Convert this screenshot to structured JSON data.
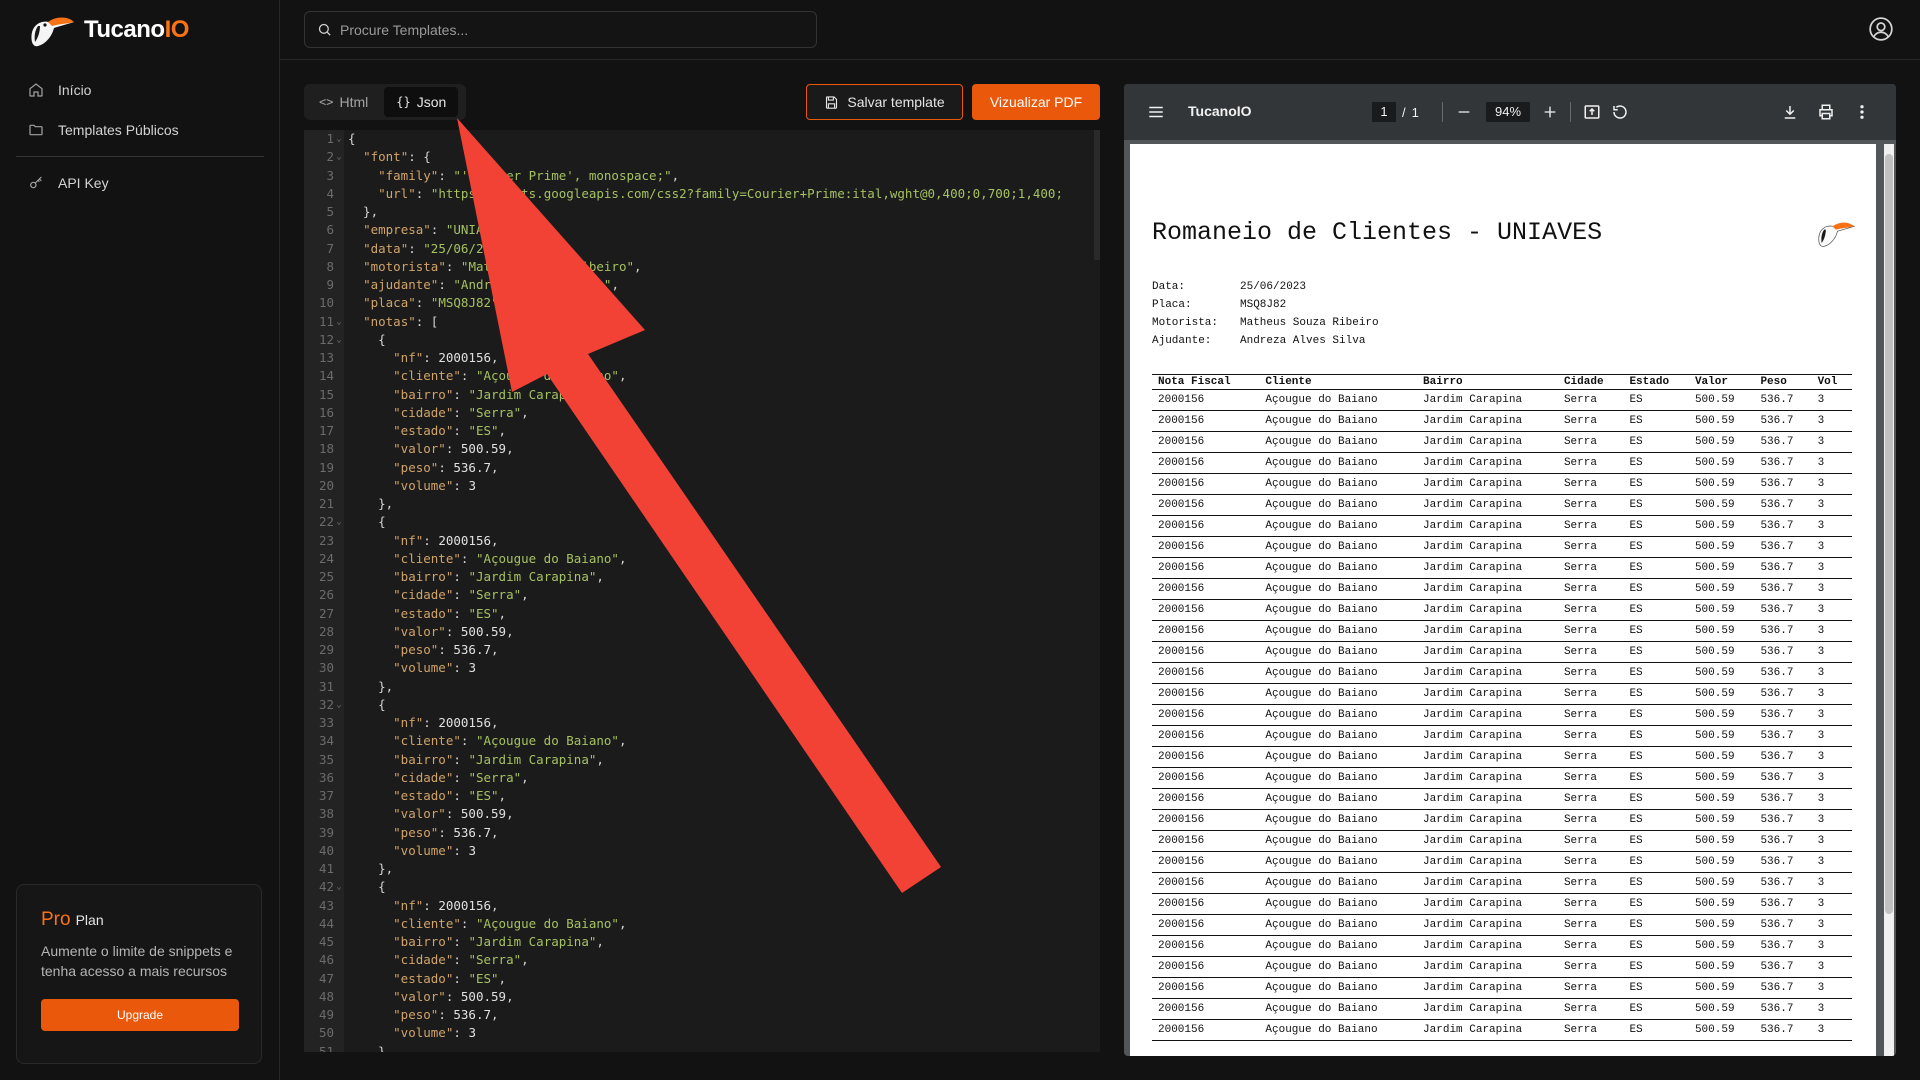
{
  "brand": {
    "name_main": "Tucano",
    "name_accent": "IO"
  },
  "sidebar": {
    "items": [
      {
        "label": "Início",
        "icon": "home-icon"
      },
      {
        "label": "Templates Públicos",
        "icon": "folder-icon"
      },
      {
        "label": "API Key",
        "icon": "key-icon"
      }
    ],
    "pro": {
      "title_accent": "Pro",
      "title_rest": "Plan",
      "description": "Aumente o limite de snippets e tenha acesso a mais recursos",
      "button": "Upgrade"
    }
  },
  "search": {
    "placeholder": "Procure Templates..."
  },
  "editor": {
    "tabs": [
      {
        "label": "Html",
        "glyph": "<>"
      },
      {
        "label": "Json",
        "glyph": "{}"
      }
    ],
    "active_tab": "Json",
    "save_label": "Salvar template",
    "preview_label": "Vizualizar PDF",
    "lines": [
      "{",
      "  \"font\": {",
      "    \"family\": \"'Courier Prime', monospace;\",",
      "    \"url\": \"https://fonts.googleapis.com/css2?family=Courier+Prime:ital,wght@0,400;0,700;1,400;",
      "  },",
      "  \"empresa\": \"UNIAVES\",",
      "  \"data\": \"25/06/2023\",",
      "  \"motorista\": \"Matheus Souza Ribeiro\",",
      "  \"ajudante\": \"Andreza Alves Silva\",",
      "  \"placa\": \"MSQ8J82\",",
      "  \"notas\": [",
      "    {",
      "      \"nf\": 2000156,",
      "      \"cliente\": \"Açougue do Baiano\",",
      "      \"bairro\": \"Jardim Carapina\",",
      "      \"cidade\": \"Serra\",",
      "      \"estado\": \"ES\",",
      "      \"valor\": 500.59,",
      "      \"peso\": 536.7,",
      "      \"volume\": 3",
      "    },",
      "    {",
      "      \"nf\": 2000156,",
      "      \"cliente\": \"Açougue do Baiano\",",
      "      \"bairro\": \"Jardim Carapina\",",
      "      \"cidade\": \"Serra\",",
      "      \"estado\": \"ES\",",
      "      \"valor\": 500.59,",
      "      \"peso\": 536.7,",
      "      \"volume\": 3",
      "    },",
      "    {",
      "      \"nf\": 2000156,",
      "      \"cliente\": \"Açougue do Baiano\",",
      "      \"bairro\": \"Jardim Carapina\",",
      "      \"cidade\": \"Serra\",",
      "      \"estado\": \"ES\",",
      "      \"valor\": 500.59,",
      "      \"peso\": 536.7,",
      "      \"volume\": 3",
      "    },",
      "    {",
      "      \"nf\": 2000156,",
      "      \"cliente\": \"Açougue do Baiano\",",
      "      \"bairro\": \"Jardim Carapina\",",
      "      \"cidade\": \"Serra\",",
      "      \"estado\": \"ES\",",
      "      \"valor\": 500.59,",
      "      \"peso\": 536.7,",
      "      \"volume\": 3",
      "    },"
    ],
    "foldable_lines": [
      1,
      2,
      11,
      12,
      22,
      32,
      42
    ]
  },
  "viewer": {
    "title": "TucanoIO",
    "page_current": "1",
    "page_total": "1",
    "zoom": "94%",
    "document": {
      "title": "Romaneio de Clientes - UNIAVES",
      "meta": [
        {
          "label": "Data:",
          "value": "25/06/2023"
        },
        {
          "label": "Placa:",
          "value": "MSQ8J82"
        },
        {
          "label": "Motorista:",
          "value": "Matheus Souza Ribeiro"
        },
        {
          "label": "Ajudante:",
          "value": "Andreza Alves Silva"
        }
      ],
      "columns": [
        "Nota Fiscal",
        "Cliente",
        "Bairro",
        "Cidade",
        "Estado",
        "Valor",
        "Peso",
        "Vol"
      ],
      "row": [
        "2000156",
        "Açougue do Baiano",
        "Jardim Carapina",
        "Serra",
        "ES",
        "500.59",
        "536.7",
        "3"
      ],
      "row_count": 31
    }
  },
  "colors": {
    "accent": "#ea580c",
    "annotation_arrow": "#f24236"
  }
}
